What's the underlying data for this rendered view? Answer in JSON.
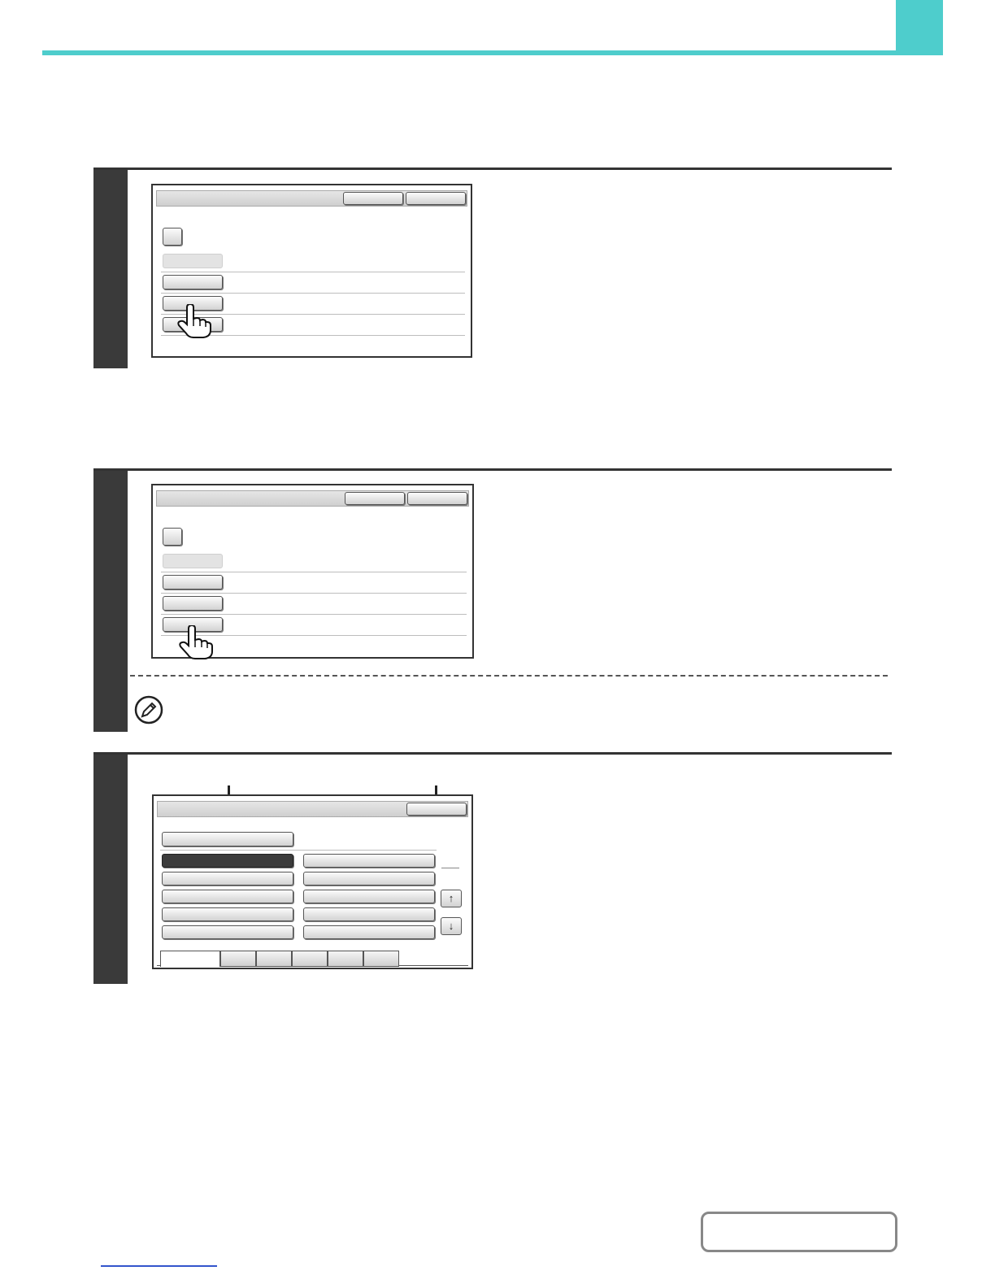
{
  "page": {
    "header_title": "",
    "steps": [
      {
        "number": "",
        "screen_title": "",
        "items": []
      },
      {
        "number": "",
        "screen_title": "",
        "items": []
      },
      {
        "number": "",
        "screen_title": "",
        "items": []
      }
    ],
    "icons": {
      "pointer": "hand-pointer-icon",
      "note": "pencil-note-icon",
      "scroll_up": "arrow-up-icon",
      "scroll_down": "arrow-down-icon"
    },
    "colors": {
      "accent": "#4ecdcc",
      "band": "#3a3a3a",
      "selected": "#3b3b3b"
    },
    "step3_screen": {
      "tab_count": 6,
      "selected_item": "left-column-first"
    }
  }
}
